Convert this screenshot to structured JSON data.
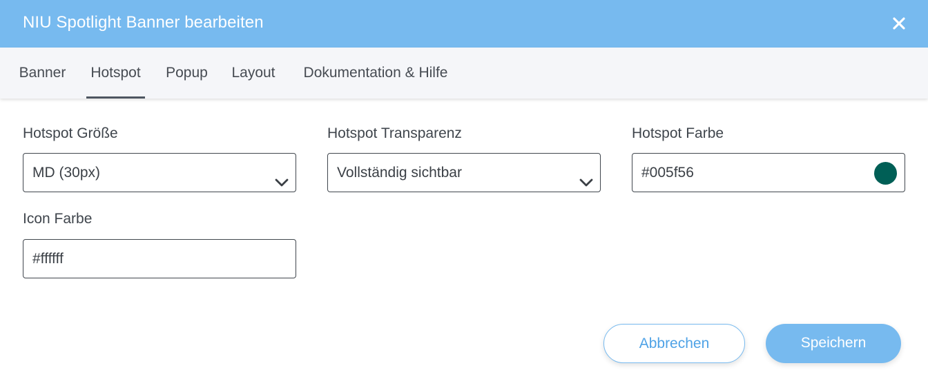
{
  "dialog": {
    "title": "NIU Spotlight Banner bearbeiten",
    "close_icon": "close-icon"
  },
  "tabs": [
    {
      "label": "Banner",
      "active": false
    },
    {
      "label": "Hotspot",
      "active": true
    },
    {
      "label": "Popup",
      "active": false
    },
    {
      "label": "Layout",
      "active": false
    },
    {
      "label": "Dokumentation & Hilfe",
      "active": false
    }
  ],
  "form": {
    "size": {
      "label": "Hotspot Größe",
      "value": "MD (30px)"
    },
    "transparency": {
      "label": "Hotspot Transparenz",
      "value": "Vollständig sichtbar"
    },
    "hotspot_color": {
      "label": "Hotspot Farbe",
      "value": "#005f56",
      "swatch": "#005f56"
    },
    "icon_color": {
      "label": "Icon Farbe",
      "value": "#ffffff"
    }
  },
  "actions": {
    "cancel": "Abbrechen",
    "save": "Speichern"
  },
  "colors": {
    "header_bg": "#77baef",
    "accent": "#77baef",
    "tab_indicator": "#4d5560"
  }
}
